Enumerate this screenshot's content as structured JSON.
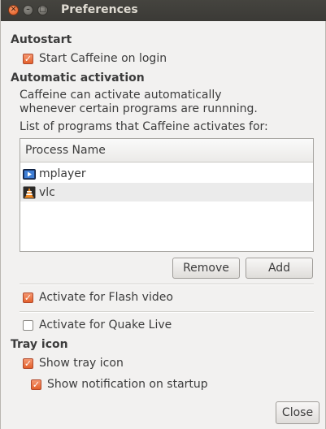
{
  "window": {
    "title": "Preferences"
  },
  "autostart": {
    "heading": "Autostart",
    "start_on_login": {
      "label": "Start Caffeine on login",
      "checked": true
    }
  },
  "auto_activation": {
    "heading": "Automatic activation",
    "description_line1": "Caffeine can activate automatically",
    "description_line2": "whenever certain programs are runnning.",
    "list_caption": "List of programs that Caffeine activates for:",
    "column_header": "Process Name",
    "programs": [
      {
        "name": "mplayer",
        "icon": "video-clapper-icon"
      },
      {
        "name": "vlc",
        "icon": "vlc-cone-icon"
      }
    ],
    "remove_label": "Remove",
    "add_label": "Add",
    "flash": {
      "label": "Activate for Flash video",
      "checked": true
    },
    "quake": {
      "label": "Activate for Quake Live",
      "checked": false
    }
  },
  "tray": {
    "heading": "Tray icon",
    "show_icon": {
      "label": "Show tray icon",
      "checked": true
    },
    "show_notification": {
      "label": "Show notification on startup",
      "checked": true
    }
  },
  "close_label": "Close",
  "colors": {
    "accent": "#e3612b",
    "titlebar": "#3b3a36"
  }
}
